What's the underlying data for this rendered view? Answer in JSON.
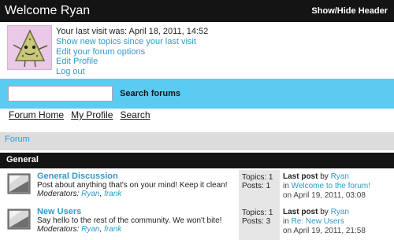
{
  "header": {
    "welcome": "Welcome Ryan",
    "show_hide": "Show/Hide Header"
  },
  "profile": {
    "avatar_icon": "tree-character-avatar",
    "last_visit": "Your last visit was: April 18, 2011, 14:52",
    "links": [
      "Show new topics since your last visit",
      "Edit your forum options",
      "Edit Profile",
      "Log out"
    ]
  },
  "search": {
    "value": "",
    "placeholder": "",
    "button": "Search forums"
  },
  "nav": {
    "items": [
      "Forum Home",
      "My Profile",
      "Search"
    ]
  },
  "breadcrumb": "Forum",
  "section": {
    "title": "General"
  },
  "forums": [
    {
      "icon": "forum-icon",
      "title": "General Discussion",
      "description": "Post about anything that's on your mind! Keep it clean!",
      "mods_label": "Moderators:",
      "mod1": "Ryan",
      "mod_sep": ", ",
      "mod2": "frank",
      "topics": "Topics: 1",
      "posts": "Posts: 1",
      "last_post_label": "Last post",
      "by": "by",
      "by_user": "Ryan",
      "in": "in",
      "in_topic": "Welcome to the forum!",
      "on": "on April 19, 2011, 03:08"
    },
    {
      "icon": "forum-icon",
      "title": "New Users",
      "description": "Say hello to the rest of the community. We won't bite!",
      "mods_label": "Moderators:",
      "mod1": "Ryan",
      "mod_sep": ", ",
      "mod2": "frank",
      "topics": "Topics: 1",
      "posts": "Posts: 3",
      "last_post_label": "Last post",
      "by": "by",
      "by_user": "Ryan",
      "in": "in",
      "in_topic": "Re: New Users",
      "on": "on April 19, 2011, 21:58"
    }
  ],
  "colors": {
    "header_bg": "#141414",
    "search_bar_bg": "#5ccbf1",
    "link": "#3399cc",
    "breadcrumb_bg": "#dcdcdc"
  }
}
